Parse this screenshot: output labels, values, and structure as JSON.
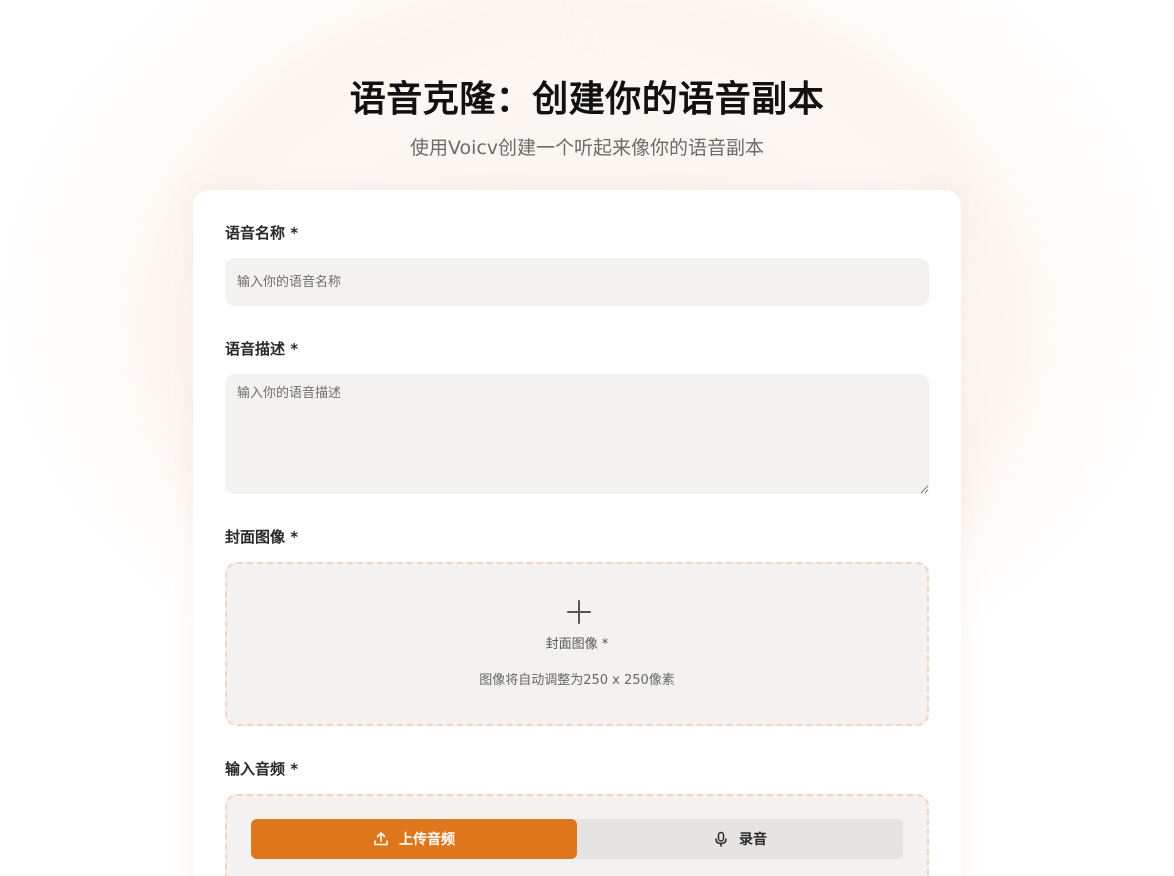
{
  "header": {
    "title": "语音克隆：创建你的语音副本",
    "subtitle": "使用Voicv创建一个听起来像你的语音副本"
  },
  "form": {
    "name": {
      "label": "语音名称 *",
      "placeholder": "输入你的语音名称",
      "value": ""
    },
    "description": {
      "label": "语音描述 *",
      "placeholder": "输入你的语音描述",
      "value": ""
    },
    "cover": {
      "label": "封面图像 *",
      "dropzone_title": "封面图像 *",
      "dropzone_hint": "图像将自动调整为250 x 250像素",
      "icon": "plus-icon"
    },
    "audio": {
      "label": "输入音频 *",
      "tabs": [
        {
          "label": "上传音频",
          "icon": "upload-icon",
          "active": true
        },
        {
          "label": "录音",
          "icon": "microphone-icon",
          "active": false
        }
      ]
    }
  },
  "colors": {
    "accent": "#e0761c",
    "input_bg": "#f3f2f0",
    "dashed_border": "#f0d6c2",
    "tab_inactive_bg": "#e5e4e2"
  }
}
